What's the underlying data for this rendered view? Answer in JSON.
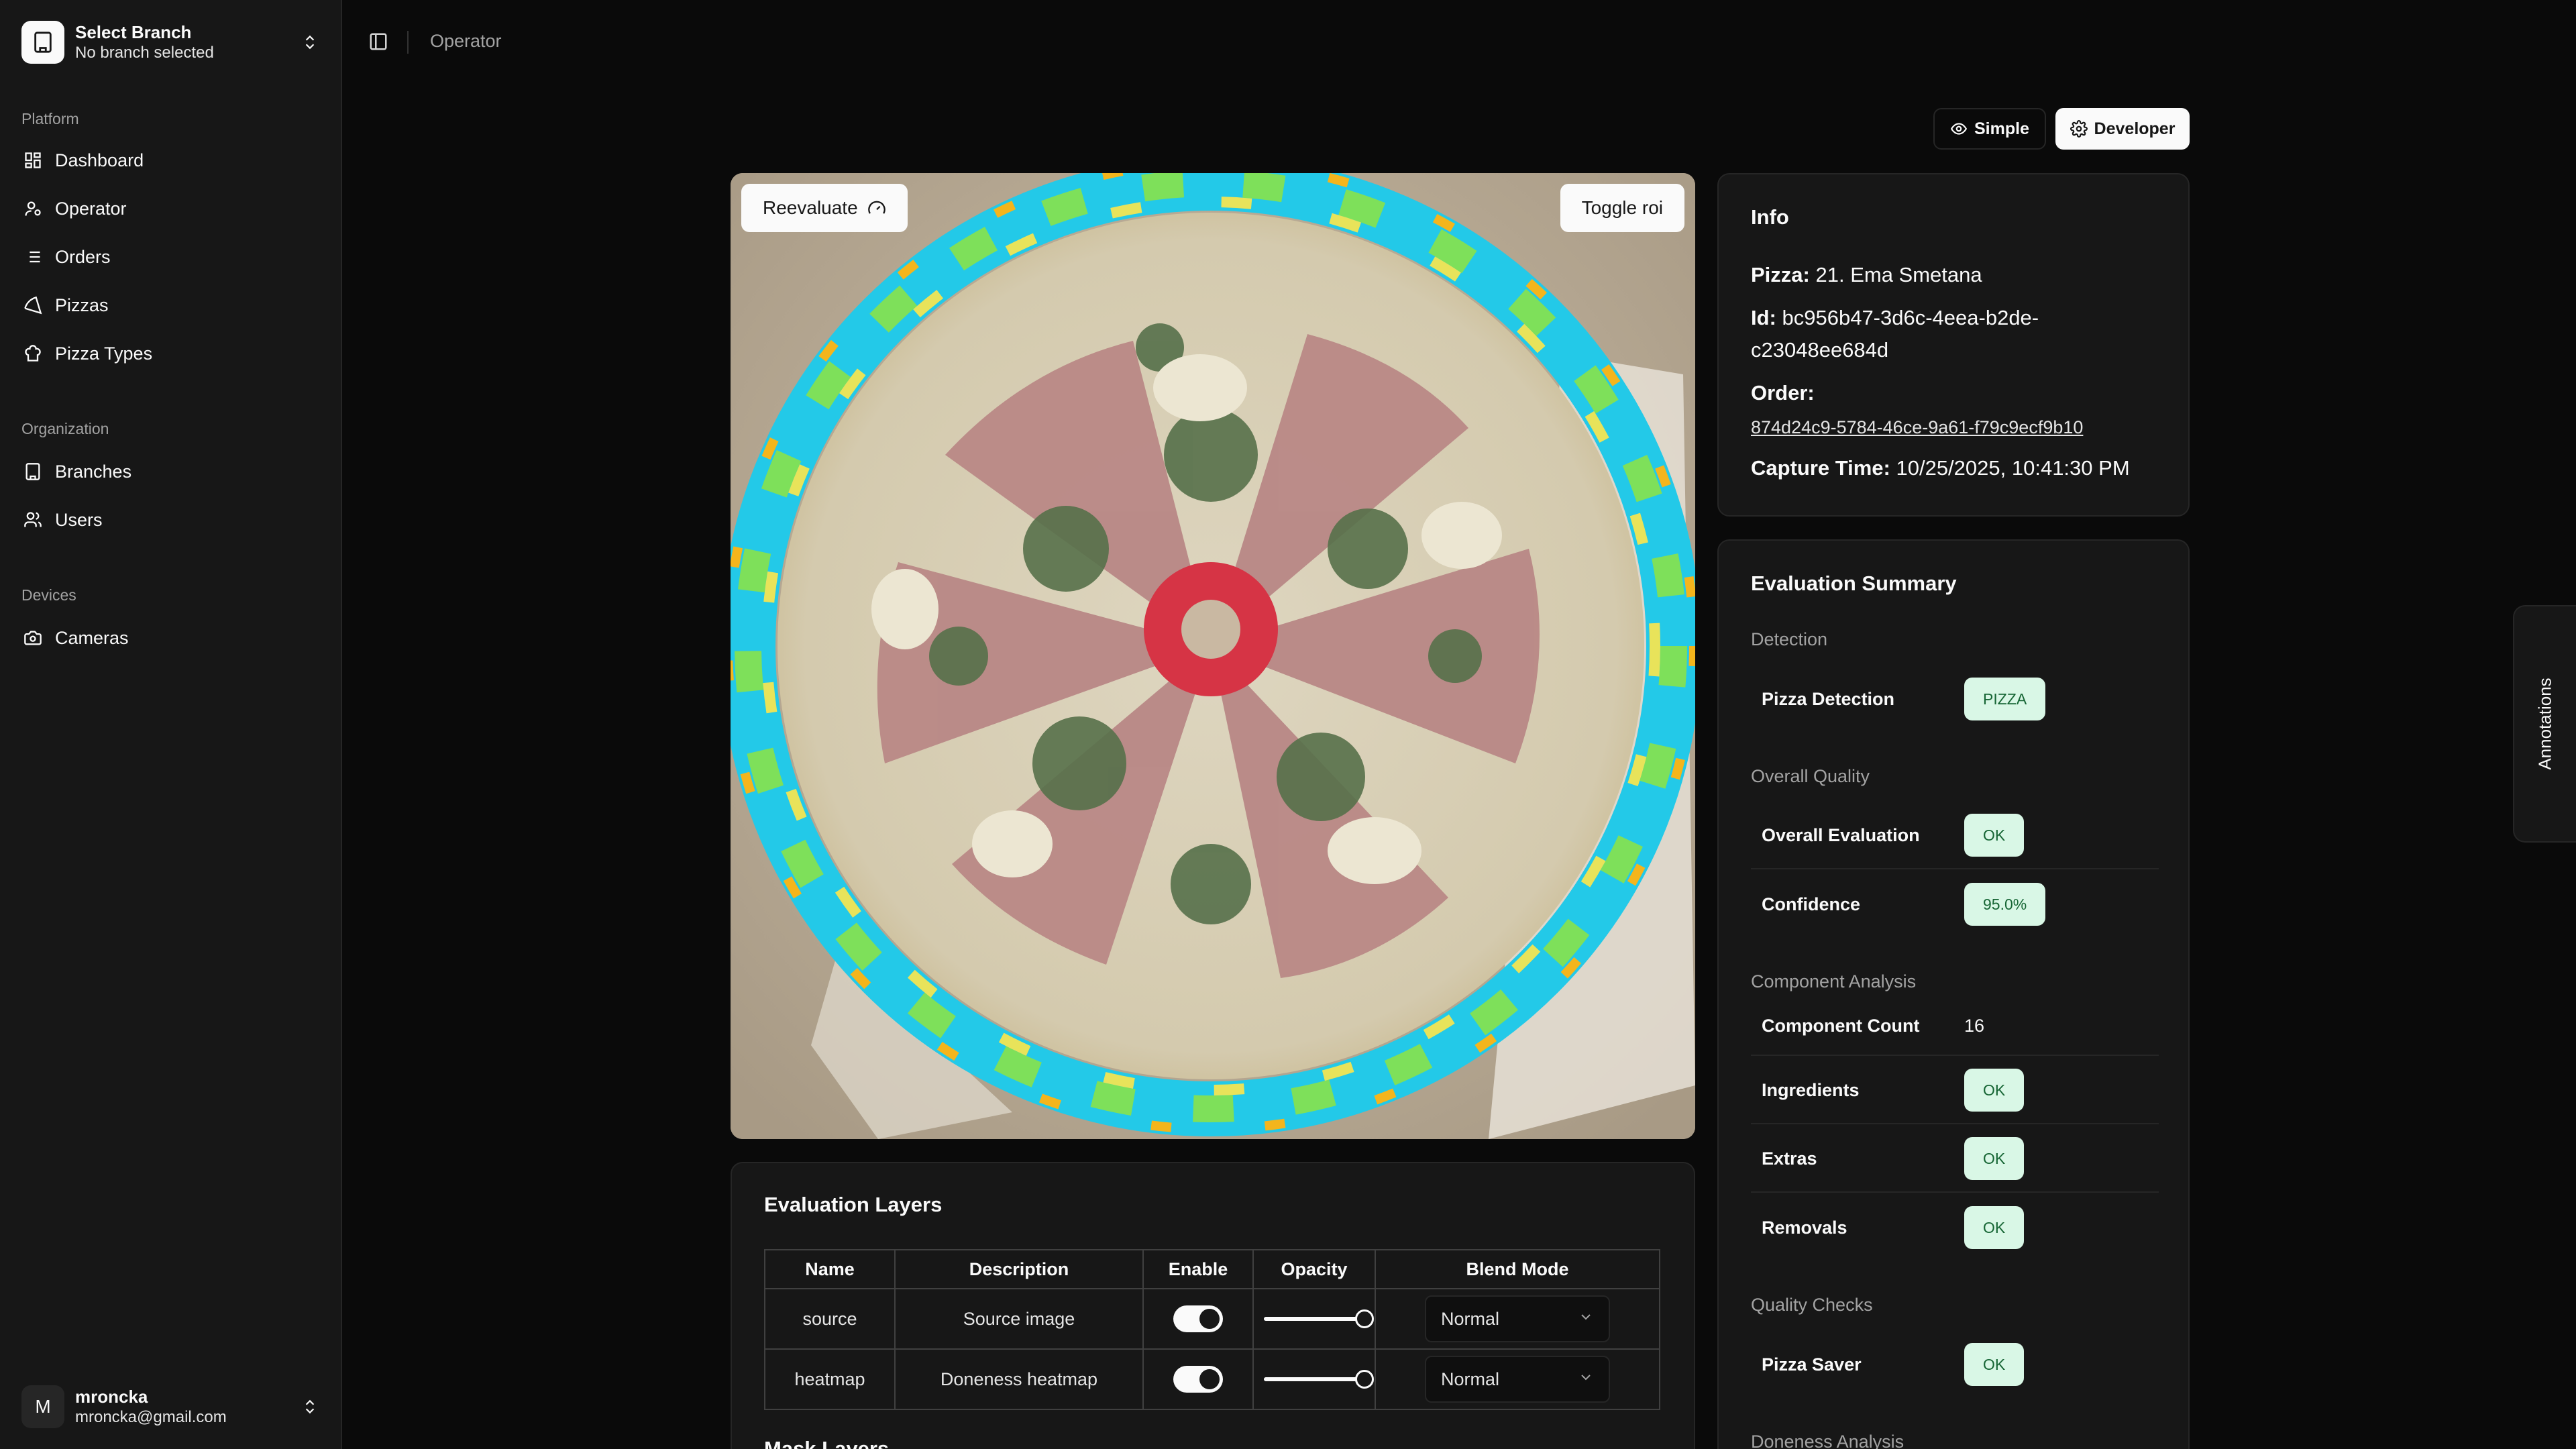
{
  "sidebar": {
    "branch": {
      "title": "Select Branch",
      "subtitle": "No branch selected"
    },
    "groups": [
      {
        "label": "Platform",
        "items": [
          {
            "label": "Dashboard",
            "icon": "layout-dashboard-icon"
          },
          {
            "label": "Operator",
            "icon": "user-cog-icon"
          },
          {
            "label": "Orders",
            "icon": "list-icon"
          },
          {
            "label": "Pizzas",
            "icon": "pizza-icon"
          },
          {
            "label": "Pizza Types",
            "icon": "chef-hat-icon"
          }
        ]
      },
      {
        "label": "Organization",
        "items": [
          {
            "label": "Branches",
            "icon": "building-icon"
          },
          {
            "label": "Users",
            "icon": "users-icon"
          }
        ]
      },
      {
        "label": "Devices",
        "items": [
          {
            "label": "Cameras",
            "icon": "camera-icon"
          }
        ]
      }
    ],
    "user": {
      "initial": "M",
      "name": "mroncka",
      "email": "mroncka@gmail.com"
    }
  },
  "header": {
    "breadcrumb": "Operator"
  },
  "view_modes": {
    "simple": "Simple",
    "developer": "Developer",
    "active": "Developer"
  },
  "image_panel": {
    "reevaluate_label": "Reevaluate",
    "toggle_roi_label": "Toggle roi"
  },
  "layers": {
    "title": "Evaluation Layers",
    "columns": [
      "Name",
      "Description",
      "Enable",
      "Opacity",
      "Blend Mode"
    ],
    "rows": [
      {
        "name": "source",
        "description": "Source image",
        "enabled": true,
        "opacity": 1.0,
        "blend_mode": "Normal"
      },
      {
        "name": "heatmap",
        "description": "Doneness heatmap",
        "enabled": true,
        "opacity": 1.0,
        "blend_mode": "Normal"
      }
    ],
    "mask_title": "Mask Layers"
  },
  "info": {
    "title": "Info",
    "pizza_label": "Pizza:",
    "pizza_value": "21. Ema Smetana",
    "id_label": "Id:",
    "id_value": "bc956b47-3d6c-4eea-b2de-c23048ee684d",
    "order_label": "Order:",
    "order_value": "874d24c9-5784-46ce-9a61-f79c9ecf9b10",
    "capture_label": "Capture Time:",
    "capture_value": "10/25/2025, 10:41:30 PM"
  },
  "summary": {
    "title": "Evaluation Summary",
    "detection": {
      "label": "Detection",
      "pizza_detection_label": "Pizza Detection",
      "pizza_detection_value": "PIZZA"
    },
    "overall": {
      "label": "Overall Quality",
      "evaluation_label": "Overall Evaluation",
      "evaluation_value": "OK",
      "confidence_label": "Confidence",
      "confidence_value": "95.0%"
    },
    "components": {
      "label": "Component Analysis",
      "count_label": "Component Count",
      "count_value": "16",
      "ingredients_label": "Ingredients",
      "ingredients_value": "OK",
      "extras_label": "Extras",
      "extras_value": "OK",
      "removals_label": "Removals",
      "removals_value": "OK"
    },
    "quality": {
      "label": "Quality Checks",
      "saver_label": "Pizza Saver",
      "saver_value": "OK"
    },
    "doneness": {
      "label": "Doneness Analysis"
    }
  },
  "annotations_tab": "Annotations",
  "colors": {
    "background": "#0a0a0a",
    "panel": "#171717",
    "border": "#262626",
    "badge_bg": "#d9f7e6",
    "badge_text": "#166534"
  }
}
